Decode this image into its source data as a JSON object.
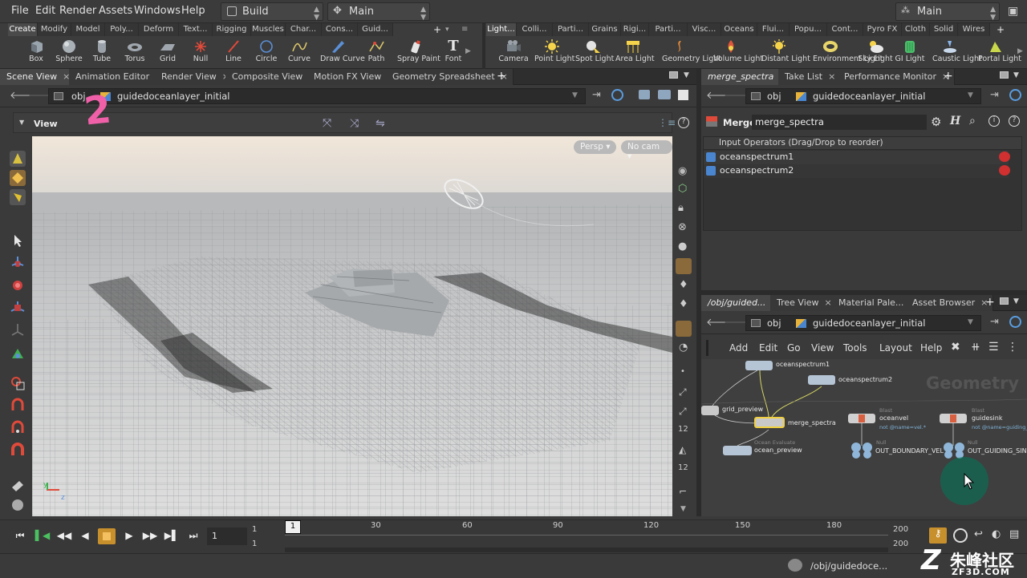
{
  "menubar": {
    "items": [
      "File",
      "Edit",
      "Render",
      "Assets",
      "Windows",
      "Help"
    ],
    "desktop_select": "Build",
    "scene_select": "Main",
    "right_select": "Main"
  },
  "shelf": {
    "left_tabs": [
      "Create",
      "Modify",
      "Model",
      "Poly...",
      "Deform",
      "Text...",
      "Rigging",
      "Muscles",
      "Char...",
      "Cons...",
      "Guid..."
    ],
    "right_tabs": [
      "Light...",
      "Colli...",
      "Parti...",
      "Grains",
      "Rigi...",
      "Parti...",
      "Visc...",
      "Oceans",
      "Flui...",
      "Popu...",
      "Cont...",
      "Pyro FX",
      "Cloth",
      "Solid",
      "Wires"
    ],
    "left_tools": [
      "Box",
      "Sphere",
      "Tube",
      "Torus",
      "Grid",
      "Null",
      "Line",
      "Circle",
      "Curve",
      "Draw Curve",
      "Path",
      "Spray Paint",
      "Font"
    ],
    "right_tools": [
      "Camera",
      "Point Light",
      "Spot Light",
      "Area Light",
      "Geometry Light",
      "Volume Light",
      "Distant Light",
      "Environment Light",
      "Sky Light",
      "GI Light",
      "Caustic Light",
      "Portal Light"
    ]
  },
  "left_pane": {
    "tabs": [
      "Scene View",
      "Animation Editor",
      "Render View",
      "Composite View",
      "Motion FX View",
      "Geometry Spreadsheet"
    ],
    "path_root": "obj",
    "path_node": "guidedoceanlayer_initial",
    "view_label": "View",
    "persp": "Persp",
    "cam": "No cam",
    "annotation": "2"
  },
  "param_pane": {
    "tabs": [
      "merge_spectra",
      "Take List",
      "Performance Monitor"
    ],
    "path_root": "obj",
    "path_node": "guidedoceanlayer_initial",
    "node_type": "Merge",
    "node_name": "merge_spectra",
    "list_header": "Input Operators (Drag/Drop to reorder)",
    "inputs": [
      "oceanspectrum1",
      "oceanspectrum2"
    ]
  },
  "network_pane": {
    "tabs": [
      "/obj/guided...",
      "Tree View",
      "Material Pale...",
      "Asset Browser"
    ],
    "path_root": "obj",
    "path_node": "guidedoceanlayer_initial",
    "menu": [
      "Add",
      "Edit",
      "Go",
      "View",
      "Tools",
      "Layout",
      "Help"
    ],
    "watermark": "Geometry",
    "nodes": {
      "oceanspectrum1": "oceanspectrum1",
      "oceanspectrum2": "oceanspectrum2",
      "grid_preview": "grid_preview",
      "merge_spectra": "merge_spectra",
      "ocean_preview": "ocean_preview",
      "ocean_preview_type": "Ocean Evaluate",
      "oceanvel": "oceanvel",
      "oceanvel_type": "Blast",
      "oceanvel_group": "not @name=vel.*",
      "guidesink": "guidesink",
      "guidesink_type": "Blast",
      "guidesink_group": "not @name=guiding_s",
      "out_boundary": "OUT_BOUNDARY_VEL",
      "out_guiding": "OUT_GUIDING_SINK",
      "null_type": "Null"
    }
  },
  "timeline": {
    "current_frame": "1",
    "start": "1",
    "start2": "1",
    "end": "200",
    "end2": "200",
    "frame_field": "1",
    "ticks": [
      "30",
      "60",
      "90",
      "120",
      "150",
      "180"
    ]
  },
  "statusbar": {
    "path": "/obj/guidedoce...",
    "watermark_cn": "朱峰社区",
    "watermark_en": "ZF3D.COM"
  }
}
